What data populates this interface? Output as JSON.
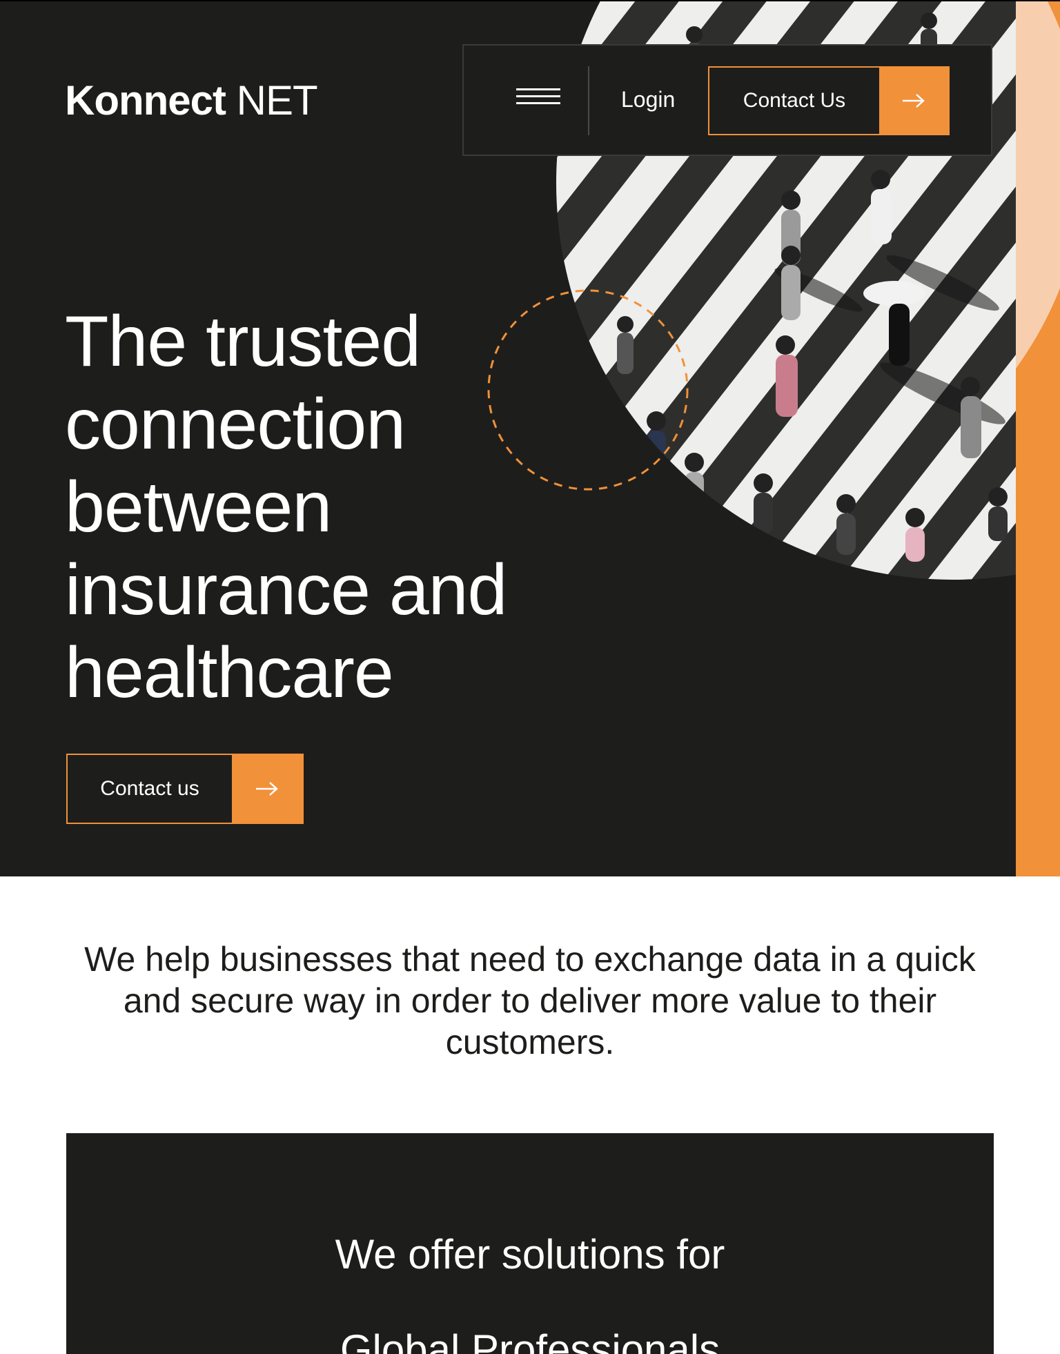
{
  "brand": {
    "name_bold": "Konnect",
    "name_light": " NET"
  },
  "nav": {
    "login_label": "Login",
    "contact_label": "Contact Us"
  },
  "hero": {
    "headline": "The trusted connection between insurance and healthcare",
    "cta_label": "Contact us"
  },
  "intro": {
    "text": "We help businesses that need to exchange data in a quick and secure way in order to deliver more value to their customers."
  },
  "solutions": {
    "title": "We offer solutions for",
    "next_item_partial": "Global Professionals"
  },
  "colors": {
    "dark": "#1d1e1c",
    "accent": "#f1913a",
    "peach": "#f8cfae",
    "white": "#ffffff"
  },
  "icons": {
    "menu": "hamburger-menu-icon",
    "arrow": "arrow-right-icon"
  }
}
